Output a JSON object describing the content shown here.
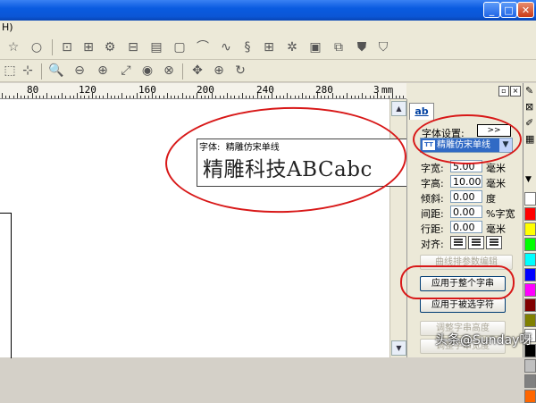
{
  "titlebar": {
    "min_glyph": "_",
    "max_glyph": "□",
    "close_glyph": "✕"
  },
  "menu": {
    "first_item": "H)"
  },
  "ruler": {
    "labels": [
      "80",
      "120",
      "160",
      "200",
      "240",
      "280",
      "3"
    ],
    "unit": "mm"
  },
  "text_object": {
    "caption_label": "字体:",
    "caption_font": "精雕仿宋单线",
    "content": "精雕科技ABCabc"
  },
  "panel": {
    "tab_label": "ab",
    "font_settings_label": "字体设置:",
    "more_button": ">>",
    "font_select_badge": "TT",
    "font_select_value": "精雕仿宋单线",
    "params": [
      {
        "label": "字宽:",
        "value": "5.00",
        "unit": "毫米"
      },
      {
        "label": "字高:",
        "value": "10.00",
        "unit": "毫米"
      },
      {
        "label": "倾斜:",
        "value": "0.00",
        "unit": "度"
      },
      {
        "label": "间距:",
        "value": "0.00",
        "unit": "%字宽"
      },
      {
        "label": "行距:",
        "value": "0.00",
        "unit": "毫米"
      }
    ],
    "align_label": "对齐:",
    "curve_button": "曲线排参数编辑",
    "apply_all_button": "应用于整个字串",
    "apply_selected_button": "应用于被选字符",
    "bottom_disabled_1": "调整字串高度",
    "bottom_disabled_2": "调整字串宽度"
  },
  "palette_colors": [
    "#ffffff",
    "#ff0000",
    "#ffff00",
    "#00ff00",
    "#00ffff",
    "#0000ff",
    "#ff00ff",
    "#800000",
    "#808000",
    "#ffffff",
    "#000000",
    "#c0c0c0",
    "#808080",
    "#ff6600"
  ],
  "annotation_color": "#d81818",
  "watermark": "头条@Sunday呀"
}
